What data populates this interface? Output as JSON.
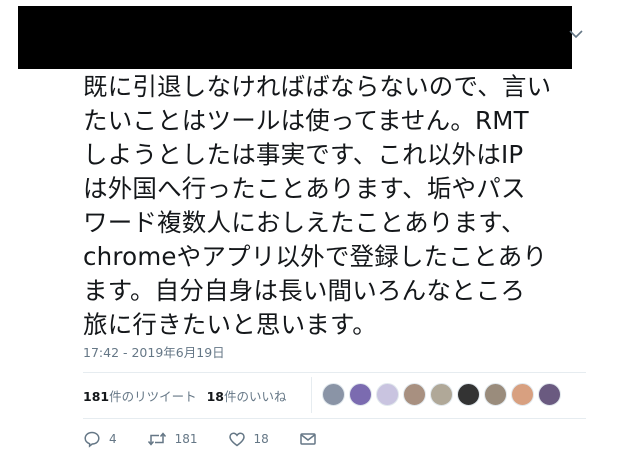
{
  "tweet": {
    "text_lines": [
      "既に引退しなければばならないので、言い",
      "たいことはツールは使ってません。RMT",
      "しようとしたは事実です、これ以外はIP",
      "は外国へ行ったことあります、垢やパス",
      "ワード複数人におしえたことあります、",
      "chromeやアプリ以外で登録したことあり",
      "ます。自分自身は長い間いろんなところ",
      "旅に行きたいと思います。"
    ],
    "timestamp": "17:42 - 2019年6月19日"
  },
  "stats": {
    "retweets_count": "181",
    "retweets_label": "件のリツイート",
    "likes_count": "18",
    "likes_label": "件のいいね"
  },
  "avatars": [
    {
      "color": "#8a94a6"
    },
    {
      "color": "#7b6bb0"
    },
    {
      "color": "#c9c4e0"
    },
    {
      "color": "#a89080"
    },
    {
      "color": "#b0a898"
    },
    {
      "color": "#333333"
    },
    {
      "color": "#9a8c7c"
    },
    {
      "color": "#d8a080"
    },
    {
      "color": "#6a5a80"
    }
  ],
  "actions": {
    "reply_count": "4",
    "retweet_count": "181",
    "like_count": "18"
  },
  "icons": {
    "caret": "chevron-down-icon",
    "reply": "reply-icon",
    "retweet": "retweet-icon",
    "like": "heart-icon",
    "dm": "envelope-icon"
  }
}
